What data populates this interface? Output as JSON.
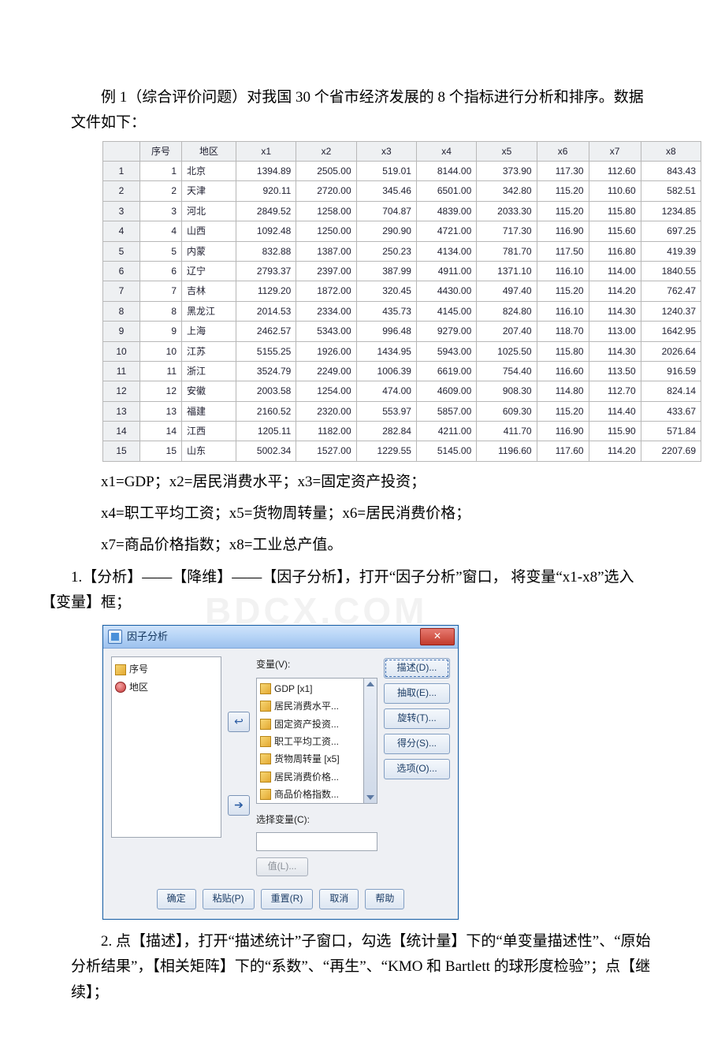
{
  "paragraphs": {
    "p1": "例 1（综合评价问题）对我国 30 个省市经济发展的 8 个指标进行分析和排序。数据文件如下：",
    "p2": "x1=GDP；x2=居民消费水平；x3=固定资产投资；",
    "p3": "x4=职工平均工资；x5=货物周转量；x6=居民消费价格；",
    "p4": "x7=商品价格指数；x8=工业总产值。",
    "p5_a": "1.【分析】——【降维】——【因子分析】，打开“因子分析”窗口，  将变量“x1-x8”选入【变量】框；",
    "p6": "2. 点【描述】，打开“描述统计”子窗口，勾选【统计量】下的“单变量描述性”、“原始分析结果”，【相关矩阵】下的“系数”、“再生”、“KMO 和 Bartlett 的球形度检验”；点【继续】；"
  },
  "watermark": "BDCX.COM",
  "data_table": {
    "columns": [
      "序号",
      "地区",
      "x1",
      "x2",
      "x3",
      "x4",
      "x5",
      "x6",
      "x7",
      "x8"
    ],
    "rows": [
      {
        "n": 1,
        "region": "北京",
        "v": [
          1394.89,
          2505.0,
          519.01,
          8144.0,
          373.9,
          117.3,
          112.6,
          843.43
        ]
      },
      {
        "n": 2,
        "region": "天津",
        "v": [
          920.11,
          2720.0,
          345.46,
          6501.0,
          342.8,
          115.2,
          110.6,
          582.51
        ]
      },
      {
        "n": 3,
        "region": "河北",
        "v": [
          2849.52,
          1258.0,
          704.87,
          4839.0,
          2033.3,
          115.2,
          115.8,
          1234.85
        ]
      },
      {
        "n": 4,
        "region": "山西",
        "v": [
          1092.48,
          1250.0,
          290.9,
          4721.0,
          717.3,
          116.9,
          115.6,
          697.25
        ]
      },
      {
        "n": 5,
        "region": "内蒙",
        "v": [
          832.88,
          1387.0,
          250.23,
          4134.0,
          781.7,
          117.5,
          116.8,
          419.39
        ]
      },
      {
        "n": 6,
        "region": "辽宁",
        "v": [
          2793.37,
          2397.0,
          387.99,
          4911.0,
          1371.1,
          116.1,
          114.0,
          1840.55
        ]
      },
      {
        "n": 7,
        "region": "吉林",
        "v": [
          1129.2,
          1872.0,
          320.45,
          4430.0,
          497.4,
          115.2,
          114.2,
          762.47
        ]
      },
      {
        "n": 8,
        "region": "黑龙江",
        "v": [
          2014.53,
          2334.0,
          435.73,
          4145.0,
          824.8,
          116.1,
          114.3,
          1240.37
        ]
      },
      {
        "n": 9,
        "region": "上海",
        "v": [
          2462.57,
          5343.0,
          996.48,
          9279.0,
          207.4,
          118.7,
          113.0,
          1642.95
        ]
      },
      {
        "n": 10,
        "region": "江苏",
        "v": [
          5155.25,
          1926.0,
          1434.95,
          5943.0,
          1025.5,
          115.8,
          114.3,
          2026.64
        ]
      },
      {
        "n": 11,
        "region": "浙江",
        "v": [
          3524.79,
          2249.0,
          1006.39,
          6619.0,
          754.4,
          116.6,
          113.5,
          916.59
        ]
      },
      {
        "n": 12,
        "region": "安徽",
        "v": [
          2003.58,
          1254.0,
          474.0,
          4609.0,
          908.3,
          114.8,
          112.7,
          824.14
        ]
      },
      {
        "n": 13,
        "region": "福建",
        "v": [
          2160.52,
          2320.0,
          553.97,
          5857.0,
          609.3,
          115.2,
          114.4,
          433.67
        ]
      },
      {
        "n": 14,
        "region": "江西",
        "v": [
          1205.11,
          1182.0,
          282.84,
          4211.0,
          411.7,
          116.9,
          115.9,
          571.84
        ]
      },
      {
        "n": 15,
        "region": "山东",
        "v": [
          5002.34,
          1527.0,
          1229.55,
          5145.0,
          1196.6,
          117.6,
          114.2,
          2207.69
        ]
      }
    ]
  },
  "dialog": {
    "title": "因子分析",
    "close": "✕",
    "left_list": [
      {
        "icon": "ruler",
        "label": "序号"
      },
      {
        "icon": "nominal",
        "label": "地区"
      }
    ],
    "var_label": "变量(V):",
    "var_list": [
      "GDP [x1]",
      "居民消费水平...",
      "固定资产投资...",
      "职工平均工资...",
      "货物周转量 [x5]",
      "居民消费价格...",
      "商品价格指数..."
    ],
    "selectvar_label": "选择变量(C):",
    "value_btn": "值(L)...",
    "side_buttons": [
      "描述(D)...",
      "抽取(E)...",
      "旋转(T)...",
      "得分(S)...",
      "选项(O)..."
    ],
    "footer_buttons": [
      "确定",
      "粘贴(P)",
      "重置(R)",
      "取消",
      "帮助"
    ]
  }
}
